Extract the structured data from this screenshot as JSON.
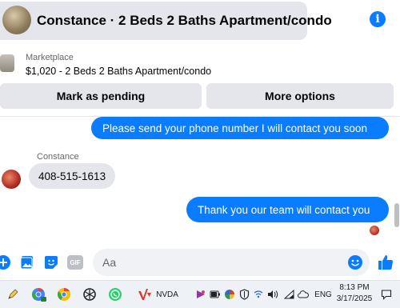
{
  "header": {
    "title": "Constance · 2 Beds 2 Baths Apartment/condo",
    "info_icon": "info-icon"
  },
  "marketplace": {
    "label": "Marketplace",
    "listing": "$1,020 - 2 Beds 2 Baths Apartment/condo"
  },
  "actions": {
    "mark_pending": "Mark as pending",
    "more_options": "More options"
  },
  "messages": [
    {
      "direction": "outgoing",
      "text": "Please send your phone number I will contact you soon"
    },
    {
      "direction": "incoming",
      "sender": "Constance",
      "text": "408-515-1613"
    },
    {
      "direction": "outgoing",
      "text": "Thank you our team will contact you"
    }
  ],
  "composer": {
    "placeholder": "Aa",
    "gif_label": "GIF",
    "icons": [
      "plus-icon",
      "image-icon",
      "sticker-icon",
      "gif-icon",
      "emoji-icon",
      "thumbs-up-icon"
    ]
  },
  "taskbar": {
    "nvda_label": "NVDA",
    "language": "ENG",
    "time": "8:13 PM",
    "date": "3/17/2025"
  },
  "colors": {
    "accent": "#0a7cff",
    "bubble_incoming": "#e4e6eb",
    "secondary_text": "#65676b"
  }
}
